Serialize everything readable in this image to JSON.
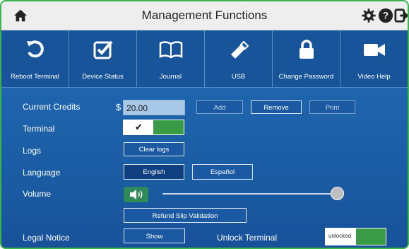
{
  "header": {
    "title": "Management Functions",
    "icons": [
      "home-icon",
      "gear-icon",
      "help-icon",
      "exit-icon"
    ]
  },
  "toolbar": {
    "items": [
      {
        "label": "Reboot Terminal",
        "icon": "reboot-icon"
      },
      {
        "label": "Device Status",
        "icon": "checkbox-icon"
      },
      {
        "label": "Journal",
        "icon": "book-icon"
      },
      {
        "label": "USB",
        "icon": "usb-icon"
      },
      {
        "label": "Change Password",
        "icon": "lock-icon"
      },
      {
        "label": "Video Help",
        "icon": "video-camera-icon"
      }
    ]
  },
  "settings": {
    "credits": {
      "label": "Current Credits",
      "currency": "$",
      "value": "20.00",
      "add": "Add",
      "remove": "Remove",
      "print": "Print"
    },
    "terminal": {
      "label": "Terminal",
      "state": "✔"
    },
    "logs": {
      "label": "Logs",
      "clear": "Clear logs"
    },
    "language": {
      "label": "Language",
      "options": [
        "English",
        "Español"
      ],
      "selected": "English"
    },
    "volume": {
      "label": "Volume",
      "level": 0.98
    },
    "refund": {
      "label": "Refund Slip Validation"
    },
    "legal": {
      "label": "Legal Notice",
      "show": "Show"
    },
    "unlock": {
      "label": "Unlock Terminal",
      "state": "unlocked"
    }
  },
  "colors": {
    "accent_green": "#3a9b47",
    "panel_blue": "#1c5fa8",
    "frame_green": "#3bb54a"
  }
}
